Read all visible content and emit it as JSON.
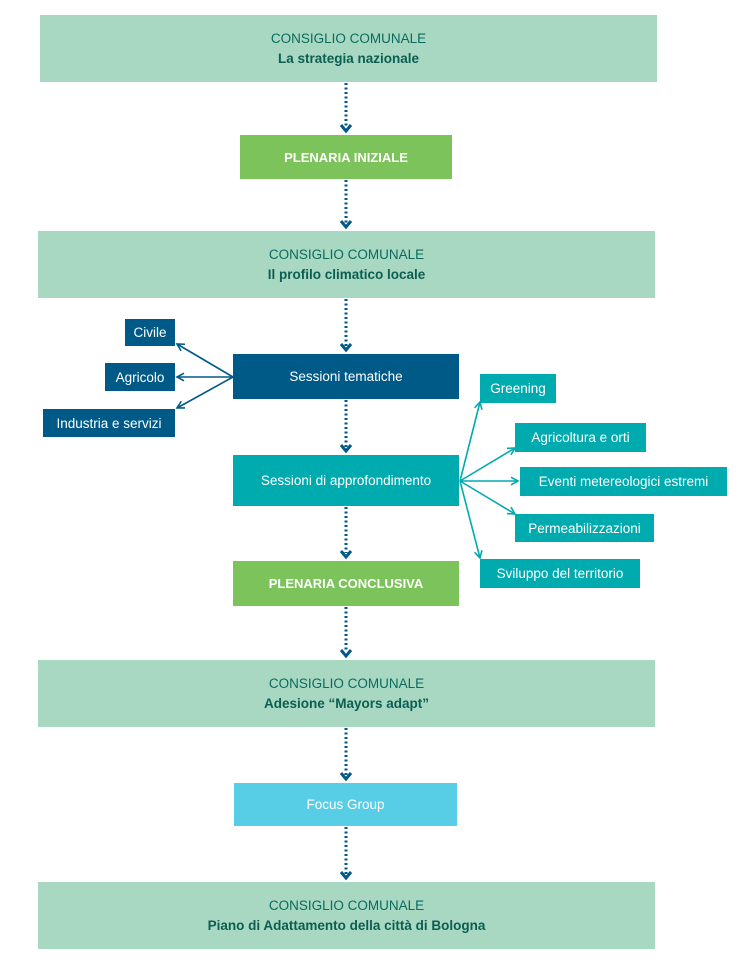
{
  "colors": {
    "council_bg": "#a8d8c2",
    "council_text": "#0a6b5e",
    "plenary_bg": "#7dc35b",
    "tematiche_bg": "#005a87",
    "approfondimento_bg": "#00abb0",
    "focus_bg": "#58cde6",
    "dotted_arrow": "#005a87"
  },
  "steps": {
    "council1": {
      "line1": "CONSIGLIO COMUNALE",
      "line2": "La strategia nazionale"
    },
    "plenary_initial": {
      "label": "PLENARIA INIZIALE"
    },
    "council2": {
      "line1": "CONSIGLIO COMUNALE",
      "line2": "Il profilo climatico locale"
    },
    "tematiche": {
      "label": "Sessioni tematiche",
      "branches": [
        "Civile",
        "Agricolo",
        "Industria e servizi"
      ]
    },
    "approfondimento": {
      "label": "Sessioni di approfondimento",
      "branches": [
        "Greening",
        "Agricoltura e orti",
        "Eventi metereologici estremi",
        "Permeabilizzazioni",
        "Sviluppo del territorio"
      ]
    },
    "plenary_final": {
      "label": "PLENARIA CONCLUSIVA"
    },
    "council3": {
      "line1": "CONSIGLIO COMUNALE",
      "line2": "Adesione “Mayors adapt”"
    },
    "focus": {
      "label": "Focus Group"
    },
    "council4": {
      "line1": "CONSIGLIO COMUNALE",
      "line2": "Piano di Adattamento della città di Bologna"
    }
  }
}
